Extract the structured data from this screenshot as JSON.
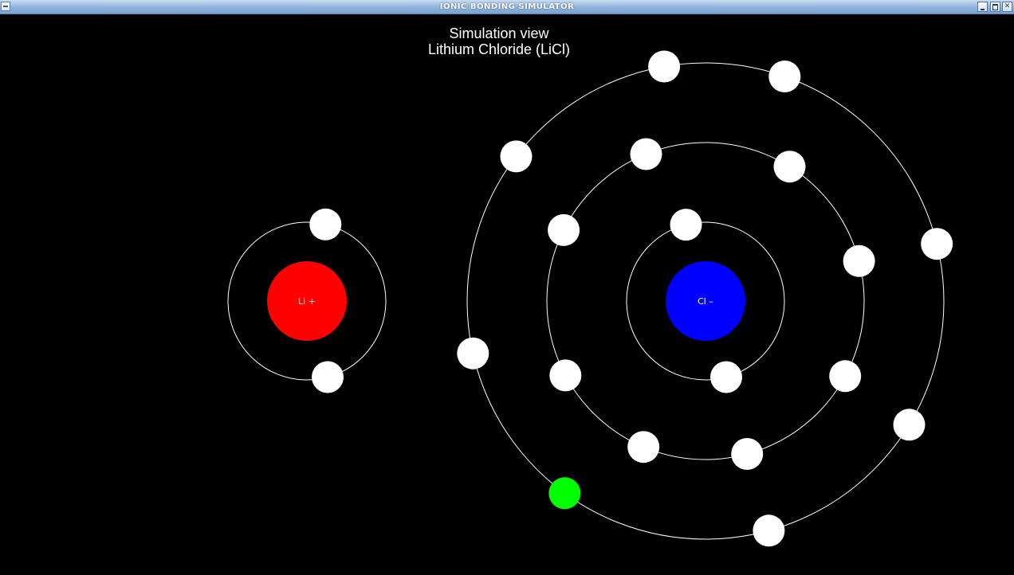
{
  "window": {
    "title": "IONIC BONDING SIMULATOR"
  },
  "view": {
    "caption_line1": "Simulation view",
    "caption_line2": "Lithium Chloride (LiCl)"
  },
  "atoms": [
    {
      "id": "lithium",
      "label": "Li +",
      "nucleus_color": "#ff0000",
      "electrons": [
        {
          "shell": 1,
          "angle_deg": 283.6
        },
        {
          "shell": 1,
          "angle_deg": 74.8
        }
      ]
    },
    {
      "id": "chlorine",
      "label": "Cl –",
      "nucleus_color": "#0000ff",
      "electrons": [
        {
          "shell": 1,
          "angle_deg": 255.7
        },
        {
          "shell": 1,
          "angle_deg": 74.8
        },
        {
          "shell": 2,
          "angle_deg": 248.0
        },
        {
          "shell": 2,
          "angle_deg": 302.0
        },
        {
          "shell": 2,
          "angle_deg": 206.6
        },
        {
          "shell": 2,
          "angle_deg": 345.4
        },
        {
          "shell": 2,
          "angle_deg": 152.0
        },
        {
          "shell": 2,
          "angle_deg": 28.3
        },
        {
          "shell": 2,
          "angle_deg": 113.0
        },
        {
          "shell": 2,
          "angle_deg": 74.8
        },
        {
          "shell": 3,
          "angle_deg": 260.0
        },
        {
          "shell": 3,
          "angle_deg": 289.4
        },
        {
          "shell": 3,
          "angle_deg": 217.4
        },
        {
          "shell": 3,
          "angle_deg": 346.1
        },
        {
          "shell": 3,
          "angle_deg": 167.3
        },
        {
          "shell": 3,
          "angle_deg": 31.3
        },
        {
          "shell": 3,
          "angle_deg": 74.6
        }
      ]
    }
  ],
  "transferred_electron": {
    "from": "lithium",
    "to": "chlorine",
    "shell": 3,
    "angle_deg": 126.2,
    "color": "#00ff00"
  },
  "colors": {
    "background": "#000000",
    "orbit": "#ffffff",
    "electron": "#ffffff"
  }
}
